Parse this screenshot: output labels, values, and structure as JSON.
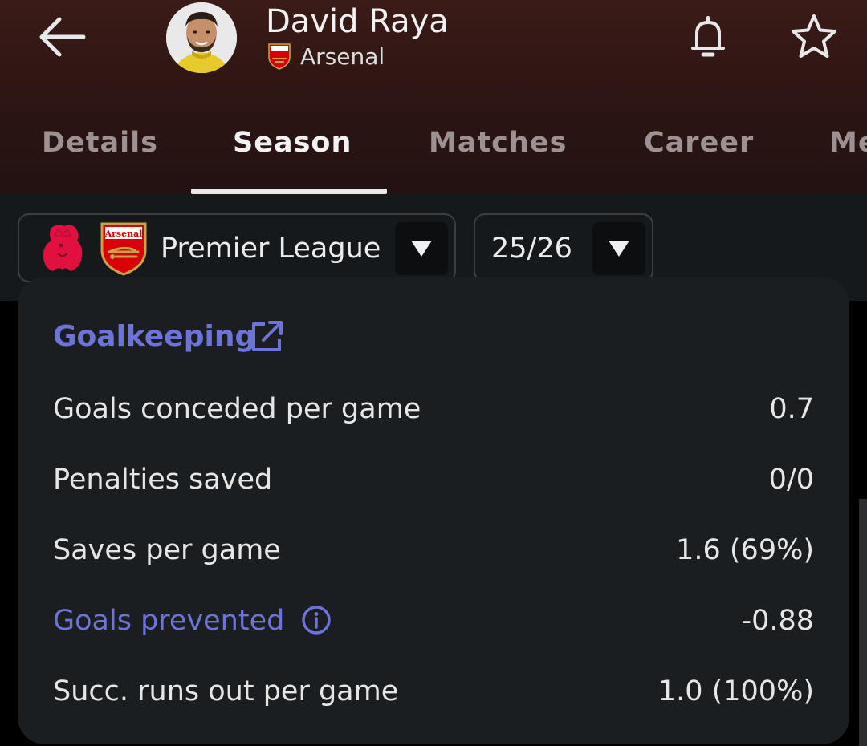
{
  "header": {
    "player_name": "David Raya",
    "team_name": "Arsenal",
    "back_icon": "arrow-left-icon",
    "bell_icon": "bell-icon",
    "star_icon": "star-outline-icon",
    "crest_text": "Arsenal"
  },
  "tabs": [
    {
      "label": "Details",
      "active": false
    },
    {
      "label": "Season",
      "active": true
    },
    {
      "label": "Matches",
      "active": false
    },
    {
      "label": "Career",
      "active": false
    },
    {
      "label": "Me",
      "active": false
    }
  ],
  "filters": {
    "competition": "Premier League",
    "season": "25/26",
    "dropdown_icon": "triangle-down-icon"
  },
  "goalkeeping": {
    "section_title": "Goalkeeping",
    "section_icon": "external-link-icon",
    "rows": [
      {
        "label": "Goals conceded per game",
        "value": "0.7"
      },
      {
        "label": "Penalties saved",
        "value": "0/0"
      },
      {
        "label": "Saves per game",
        "value": "1.6 (69%)"
      },
      {
        "label": "Goals prevented",
        "value": "-0.88",
        "info_icon": "info-circle-icon"
      },
      {
        "label": "Succ. runs out per game",
        "value": "1.0 (100%)"
      }
    ]
  },
  "colors": {
    "accent": "#6d74d8",
    "header_bg": "#2c1513",
    "card_bg": "#1b1e20",
    "arsenal_red": "#db0007"
  }
}
